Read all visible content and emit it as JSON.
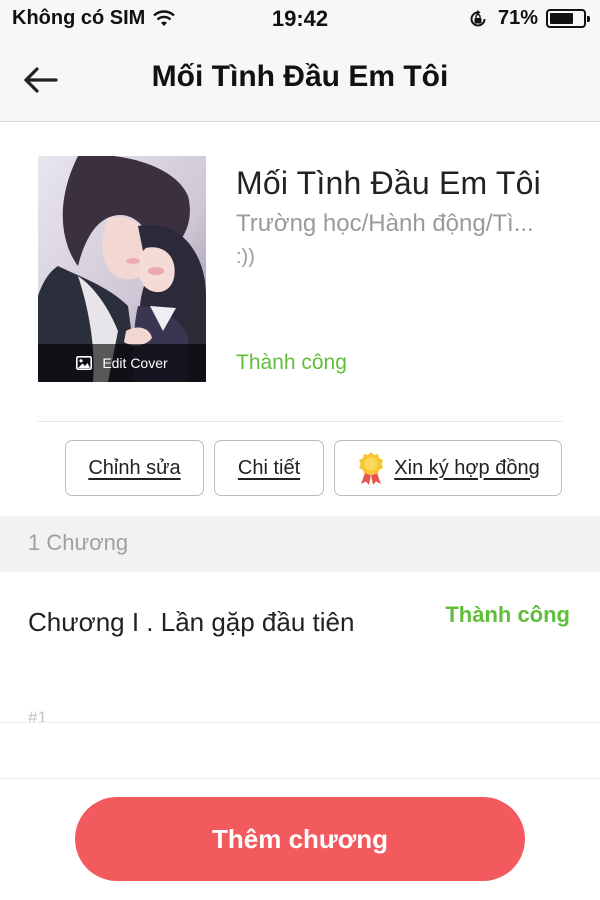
{
  "status_bar": {
    "carrier": "Không có SIM",
    "time": "19:42",
    "battery_percent": "71%",
    "battery_level": 0.71
  },
  "nav": {
    "title": "Mối Tình Đầu Em Tôi",
    "back_icon": "arrow-left-icon"
  },
  "book": {
    "edit_cover_label": "Edit Cover",
    "title": "Mối Tình Đầu Em Tôi",
    "genre": "Trường học/Hành động/Tì...",
    "description": ":))",
    "status": "Thành công"
  },
  "actions": {
    "edit_label": "Chỉnh sửa",
    "detail_label": "Chi tiết",
    "contract_label": "Xin ký hợp đồng"
  },
  "chapters": {
    "count_label": "1 Chương",
    "items": [
      {
        "title": "Chương I . Lần gặp đầu tiên",
        "status": "Thành công",
        "number": "#1"
      }
    ]
  },
  "footer": {
    "add_chapter_label": "Thêm chương"
  },
  "colors": {
    "accent_red": "#f25a5d",
    "success_green": "#5fbf3a",
    "muted_gray": "#9a9a9a"
  }
}
